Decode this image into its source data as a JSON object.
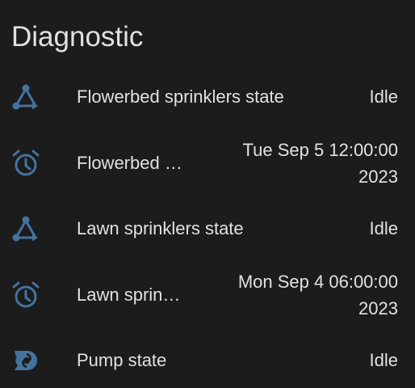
{
  "section": {
    "title": "Diagnostic"
  },
  "accent_color": "#44739e",
  "rows": [
    {
      "icon": "state-machine-icon",
      "name": "Flowerbed sprinklers state",
      "value": "Idle"
    },
    {
      "icon": "alarm-clock-icon",
      "name": "Flowerbed …",
      "value": "Tue Sep 5 12:00:00 2023"
    },
    {
      "icon": "state-machine-icon",
      "name": "Lawn sprinklers state",
      "value": "Idle"
    },
    {
      "icon": "alarm-clock-icon",
      "name": "Lawn sprin…",
      "value": "Mon Sep 4 06:00:00 2023"
    },
    {
      "icon": "pump-icon",
      "name": "Pump state",
      "value": "Idle"
    }
  ]
}
